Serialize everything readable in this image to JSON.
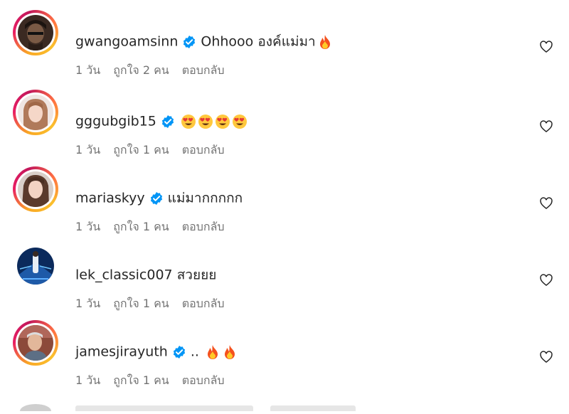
{
  "comments": [
    {
      "username": "gwangoamsinn",
      "verified": true,
      "text": "Ohhooo องค์แม่มา",
      "emojis": [
        "fire"
      ],
      "time": "1 วัน",
      "likes": "ถูกใจ 2 คน",
      "reply": "ตอบกลับ",
      "avatar": "dark-portrait",
      "ring": true
    },
    {
      "username": "gggubgib15",
      "verified": true,
      "text": "",
      "emojis": [
        "heart-eyes",
        "heart-eyes",
        "heart-eyes",
        "heart-eyes"
      ],
      "time": "1 วัน",
      "likes": "ถูกใจ 1 คน",
      "reply": "ตอบกลับ",
      "avatar": "light-portrait",
      "ring": true
    },
    {
      "username": "mariaskyy",
      "verified": true,
      "text": "แม่มากกกกก",
      "emojis": [],
      "time": "1 วัน",
      "likes": "ถูกใจ 1 คน",
      "reply": "ตอบกลับ",
      "avatar": "light-portrait",
      "ring": true
    },
    {
      "username": "lek_classic007",
      "verified": false,
      "text": "สวยยย",
      "emojis": [],
      "time": "1 วัน",
      "likes": "ถูกใจ 1 คน",
      "reply": "ตอบกลับ",
      "avatar": "blue-stage",
      "ring": false
    },
    {
      "username": "jamesjirayuth",
      "verified": true,
      "text": "..",
      "emojis": [
        "fire",
        "fire"
      ],
      "time": "1 วัน",
      "likes": "ถูกใจ 1 คน",
      "reply": "ตอบกลับ",
      "avatar": "man-portrait",
      "ring": true
    }
  ],
  "colors": {
    "verified": "#0095f6",
    "meta": "#737373",
    "text": "#262626"
  },
  "icons": {
    "like": "heart-outline-icon",
    "verified": "verified-badge-icon"
  }
}
